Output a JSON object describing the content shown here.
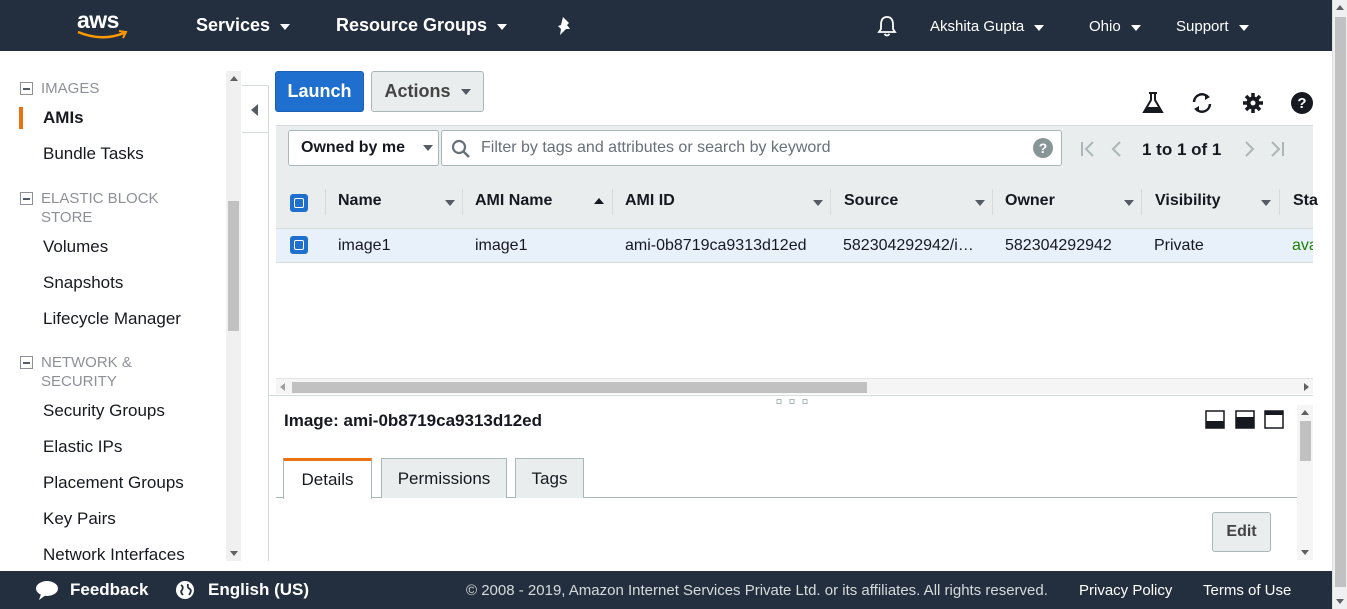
{
  "nav": {
    "logo": "aws",
    "services": "Services",
    "resource_groups": "Resource Groups",
    "user": "Akshita Gupta",
    "region": "Ohio",
    "support": "Support"
  },
  "sidebar": {
    "groups": [
      {
        "title": "IMAGES",
        "items": [
          "AMIs",
          "Bundle Tasks"
        ]
      },
      {
        "title_line1": "ELASTIC BLOCK",
        "title_line2": "STORE",
        "items": [
          "Volumes",
          "Snapshots",
          "Lifecycle Manager"
        ]
      },
      {
        "title_line1": "NETWORK &",
        "title_line2": "SECURITY",
        "items": [
          "Security Groups",
          "Elastic IPs",
          "Placement Groups",
          "Key Pairs",
          "Network Interfaces"
        ]
      }
    ],
    "active_item": "AMIs"
  },
  "toolbar": {
    "launch": "Launch",
    "actions": "Actions"
  },
  "filter": {
    "owned_by": "Owned by me",
    "search_placeholder": "Filter by tags and attributes or search by keyword",
    "pager": "1 to 1 of 1"
  },
  "table": {
    "columns": [
      "Name",
      "AMI Name",
      "AMI ID",
      "Source",
      "Owner",
      "Visibility",
      "Sta"
    ],
    "rows": [
      {
        "name": "image1",
        "ami_name": "image1",
        "ami_id": "ami-0b8719ca9313d12ed",
        "source": "582304292942/i…",
        "owner": "582304292942",
        "visibility": "Private",
        "status": "ava"
      }
    ]
  },
  "detail": {
    "title": "Image: ami-0b8719ca9313d12ed",
    "tabs": [
      "Details",
      "Permissions",
      "Tags"
    ],
    "active_tab": "Details",
    "edit": "Edit"
  },
  "footer": {
    "feedback": "Feedback",
    "language": "English (US)",
    "copyright": "© 2008 - 2019, Amazon Internet Services Private Ltd. or its affiliates. All rights reserved.",
    "privacy": "Privacy Policy",
    "terms": "Terms of Use"
  },
  "colors": {
    "nav_bg": "#232f3e",
    "primary": "#1e6fce",
    "accent": "#ec7211",
    "status_green": "#1d8102"
  }
}
